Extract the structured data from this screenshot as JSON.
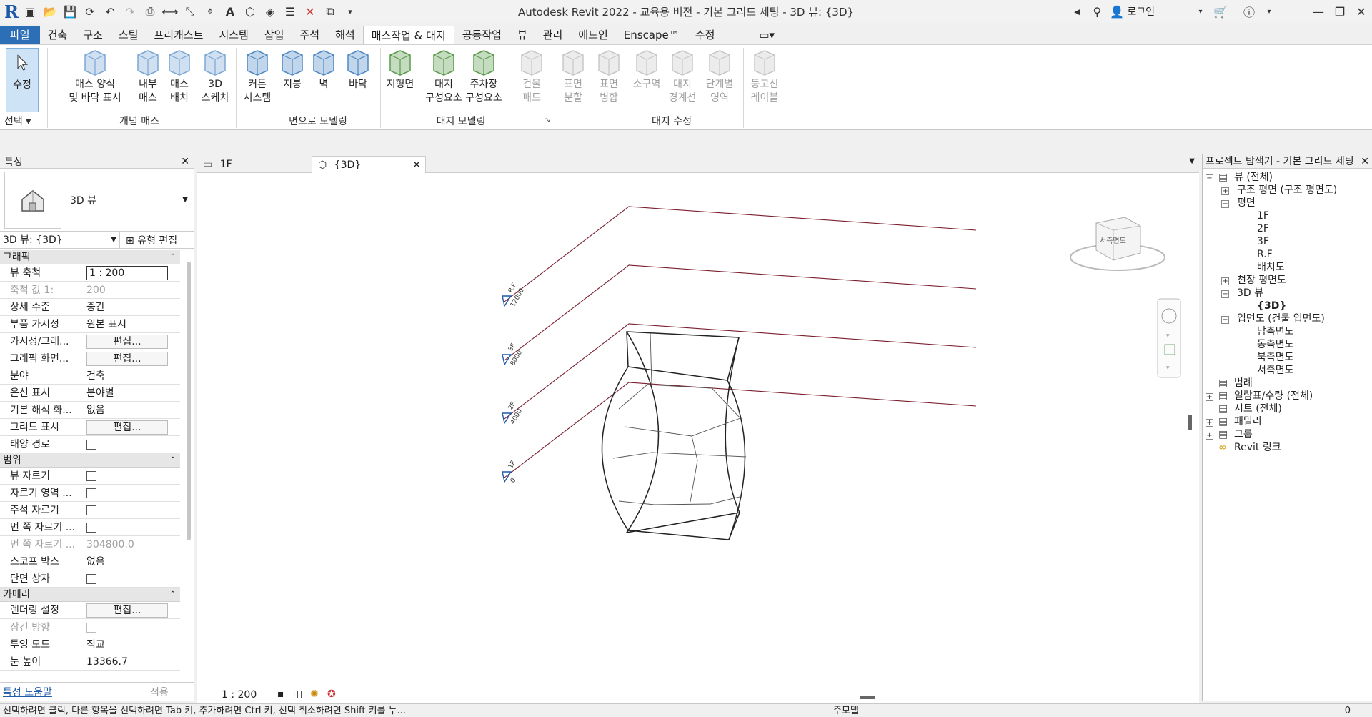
{
  "titlebar": {
    "title": "Autodesk Revit 2022 - 교육용 버전 - 기본 그리드 세팅 - 3D 뷰: {3D}",
    "login": "로그인"
  },
  "tabs": [
    "파일",
    "건축",
    "구조",
    "스틸",
    "프리캐스트",
    "시스템",
    "삽입",
    "주석",
    "해석",
    "매스작업 & 대지",
    "공동작업",
    "뷰",
    "관리",
    "애드인",
    "Enscape™",
    "수정"
  ],
  "active_tab": "매스작업 & 대지",
  "ribbon": {
    "modify": "수정",
    "select": "선택",
    "conceptual": {
      "label": "개념 매스",
      "tools": [
        {
          "l1": "매스 양식",
          "l2": "및 바닥 표시"
        },
        {
          "l1": "내부",
          "l2": "매스"
        },
        {
          "l1": "매스",
          "l2": "배치"
        },
        {
          "l1": "3D",
          "l2": "스케치"
        }
      ]
    },
    "faces": {
      "label": "면으로 모델링",
      "tools": [
        {
          "l1": "커튼",
          "l2": "시스템"
        },
        {
          "l1": "지붕",
          "l2": ""
        },
        {
          "l1": "벽",
          "l2": ""
        },
        {
          "l1": "바닥",
          "l2": ""
        }
      ]
    },
    "site": {
      "label": "대지 모델링",
      "tools": [
        {
          "l1": "지형면",
          "l2": ""
        },
        {
          "l1": "대지",
          "l2": "구성요소"
        },
        {
          "l1": "주차장",
          "l2": "구성요소"
        },
        {
          "l1": "건물",
          "l2": "패드"
        }
      ]
    },
    "modify_site": {
      "label": "대지 수정",
      "tools": [
        {
          "l1": "표면",
          "l2": "분할"
        },
        {
          "l1": "표면",
          "l2": "병합"
        },
        {
          "l1": "소구역",
          "l2": ""
        },
        {
          "l1": "대지",
          "l2": "경계선"
        },
        {
          "l1": "단계별",
          "l2": "영역"
        },
        {
          "l1": "등고선",
          "l2": "레이블"
        }
      ]
    }
  },
  "properties": {
    "header": "특성",
    "type_name": "3D 뷰",
    "view_selector": "3D 뷰: {3D}",
    "edit_type": "유형 편집",
    "sections": [
      {
        "title": "그래픽",
        "rows": [
          {
            "name": "뷰 축척",
            "value": "1 : 200",
            "kind": "input"
          },
          {
            "name": "축척 값    1:",
            "value": "200",
            "kind": "dim"
          },
          {
            "name": "상세 수준",
            "value": "중간",
            "kind": "text"
          },
          {
            "name": "부품 가시성",
            "value": "원본 표시",
            "kind": "text"
          },
          {
            "name": "가시성/그래...",
            "value": "편집...",
            "kind": "button"
          },
          {
            "name": "그래픽 화면...",
            "value": "편집...",
            "kind": "button"
          },
          {
            "name": "분야",
            "value": "건축",
            "kind": "text"
          },
          {
            "name": "은선 표시",
            "value": "분야별",
            "kind": "text"
          },
          {
            "name": "기본 해석 화...",
            "value": "없음",
            "kind": "text"
          },
          {
            "name": "그리드 표시",
            "value": "편집...",
            "kind": "button"
          },
          {
            "name": "태양 경로",
            "value": "",
            "kind": "check"
          }
        ]
      },
      {
        "title": "범위",
        "rows": [
          {
            "name": "뷰 자르기",
            "value": "",
            "kind": "check"
          },
          {
            "name": "자르기 영역 ...",
            "value": "",
            "kind": "check"
          },
          {
            "name": "주석 자르기",
            "value": "",
            "kind": "check"
          },
          {
            "name": "먼 쪽 자르기 ...",
            "value": "",
            "kind": "check"
          },
          {
            "name": "먼 쪽 자르기 ...",
            "value": "304800.0",
            "kind": "dim"
          },
          {
            "name": "스코프 박스",
            "value": "없음",
            "kind": "text"
          },
          {
            "name": "단면 상자",
            "value": "",
            "kind": "check"
          }
        ]
      },
      {
        "title": "카메라",
        "rows": [
          {
            "name": "렌더링 설정",
            "value": "편집...",
            "kind": "button"
          },
          {
            "name": "잠긴 방향",
            "value": "",
            "kind": "dimcheck"
          },
          {
            "name": "투영 모드",
            "value": "직교",
            "kind": "text"
          },
          {
            "name": "눈 높이",
            "value": "13366.7",
            "kind": "text"
          }
        ]
      }
    ],
    "help": "특성 도움말",
    "apply": "적용"
  },
  "view_tabs": [
    {
      "label": "1F",
      "active": false
    },
    {
      "label": "{3D}",
      "active": true
    }
  ],
  "canvas": {
    "scale": "1 : 200",
    "viewcube": "서측면도",
    "levels": [
      {
        "name": "R.F",
        "elev": "12000"
      },
      {
        "name": "3F",
        "elev": "8000"
      },
      {
        "name": "2F",
        "elev": "4000"
      },
      {
        "name": "1F",
        "elev": "0"
      }
    ]
  },
  "browser": {
    "header": "프로젝트 탐색기 - 기본 그리드 세팅",
    "nodes": [
      {
        "label": "뷰 (전체)",
        "depth": 0,
        "box": "−",
        "icon": true
      },
      {
        "label": "구조 평면 (구조 평면도)",
        "depth": 1,
        "box": "+"
      },
      {
        "label": "평면",
        "depth": 1,
        "box": "−"
      },
      {
        "label": "1F",
        "depth": 2,
        "box": ""
      },
      {
        "label": "2F",
        "depth": 2,
        "box": ""
      },
      {
        "label": "3F",
        "depth": 2,
        "box": ""
      },
      {
        "label": "R.F",
        "depth": 2,
        "box": ""
      },
      {
        "label": "배치도",
        "depth": 2,
        "box": ""
      },
      {
        "label": "천장 평면도",
        "depth": 1,
        "box": "+"
      },
      {
        "label": "3D 뷰",
        "depth": 1,
        "box": "−"
      },
      {
        "label": "{3D}",
        "depth": 2,
        "box": "",
        "bold": true
      },
      {
        "label": "입면도 (건물 입면도)",
        "depth": 1,
        "box": "−"
      },
      {
        "label": "남측면도",
        "depth": 2,
        "box": ""
      },
      {
        "label": "동측면도",
        "depth": 2,
        "box": ""
      },
      {
        "label": "북측면도",
        "depth": 2,
        "box": ""
      },
      {
        "label": "서측면도",
        "depth": 2,
        "box": ""
      },
      {
        "label": "범례",
        "depth": 0,
        "box": "",
        "icon": true
      },
      {
        "label": "일람표/수량 (전체)",
        "depth": 0,
        "box": "+",
        "icon": true
      },
      {
        "label": "시트 (전체)",
        "depth": 0,
        "box": "",
        "icon": true
      },
      {
        "label": "패밀리",
        "depth": 0,
        "box": "+",
        "icon": true
      },
      {
        "label": "그룹",
        "depth": 0,
        "box": "+",
        "icon": true
      },
      {
        "label": "Revit 링크",
        "depth": 0,
        "box": "",
        "icon": true,
        "link": true
      }
    ]
  },
  "statusbar": {
    "text": "선택하려면 클릭, 다른 항목을 선택하려면 Tab 키, 추가하려면 Ctrl 키, 선택 취소하려면 Shift 키를 누...",
    "main_model": "주모델",
    "count": "0"
  }
}
